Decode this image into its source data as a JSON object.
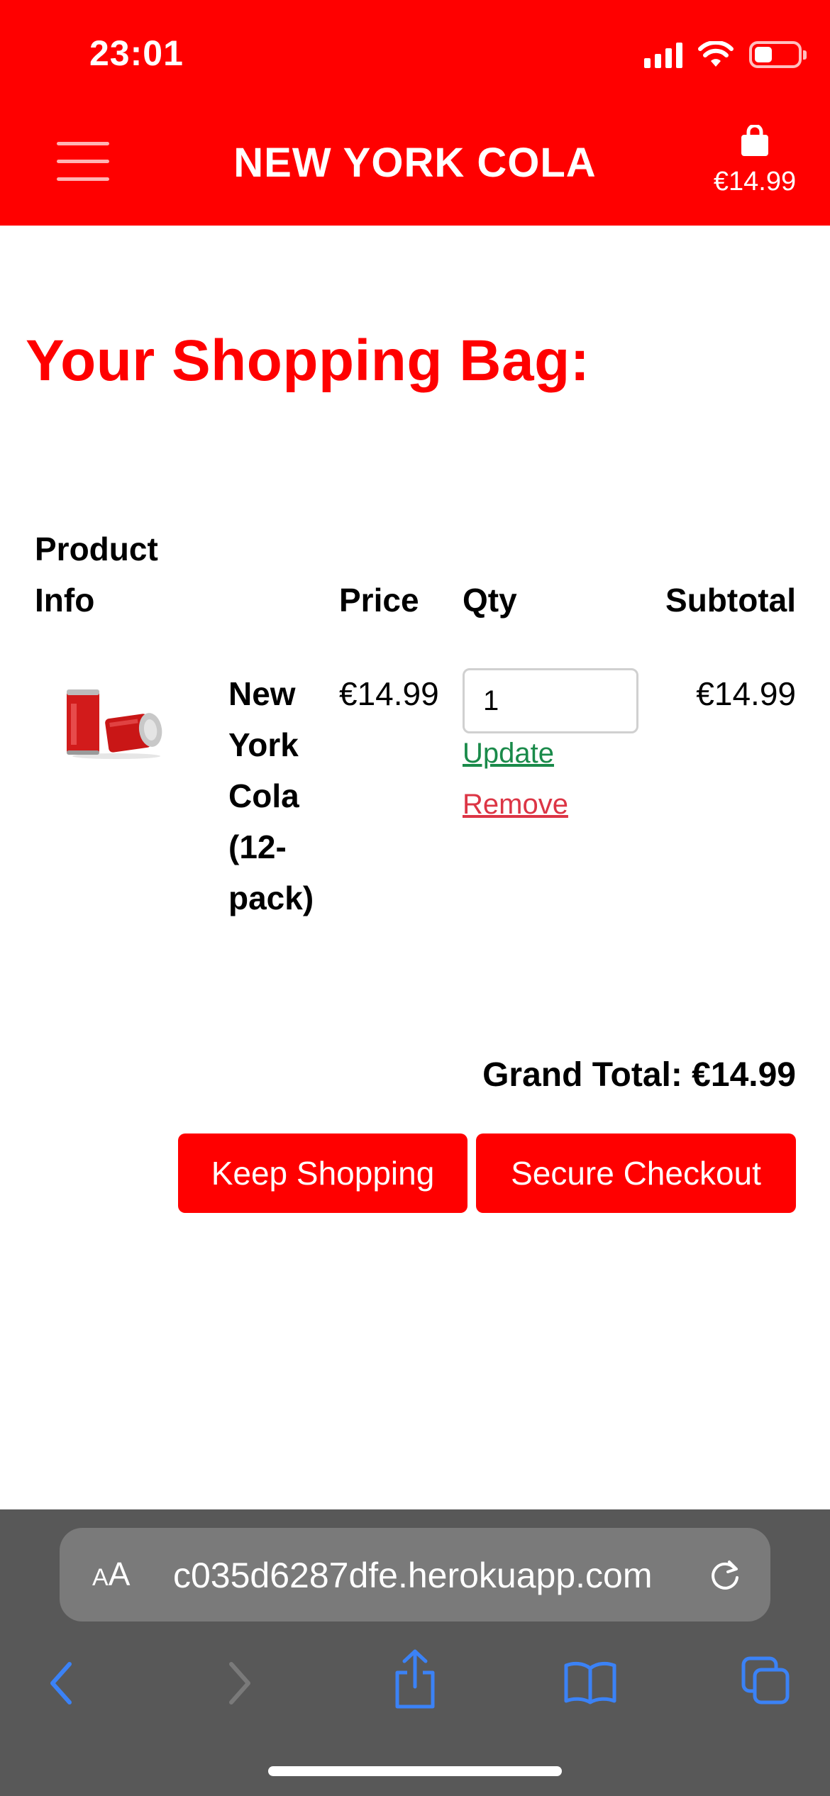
{
  "status_bar": {
    "time": "23:01"
  },
  "header": {
    "brand": "NEW YORK COLA",
    "bag_total": "€14.99",
    "colors": {
      "brand_red": "#ff0000"
    }
  },
  "page": {
    "title": "Your Shopping Bag:"
  },
  "table": {
    "headers": {
      "product_line1": "Product",
      "product_line2": "Info",
      "price": "Price",
      "qty": "Qty",
      "subtotal": "Subtotal"
    },
    "rows": [
      {
        "image_icon": "cola-cans-image",
        "name_lines": [
          "New",
          "York",
          "Cola",
          "(12-",
          "pack)"
        ],
        "price": "€14.99",
        "qty": "1",
        "update_label": "Update",
        "remove_label": "Remove",
        "subtotal": "€14.99"
      }
    ]
  },
  "summary": {
    "grand_total": "Grand Total: €14.99",
    "keep_shopping": "Keep Shopping",
    "checkout": "Secure Checkout"
  },
  "browser": {
    "text_size_button": "AA",
    "url": "c035d6287dfe.herokuapp.com",
    "icons": [
      "back-icon",
      "forward-icon",
      "share-icon",
      "bookmarks-icon",
      "tabs-icon",
      "reload-icon"
    ]
  }
}
